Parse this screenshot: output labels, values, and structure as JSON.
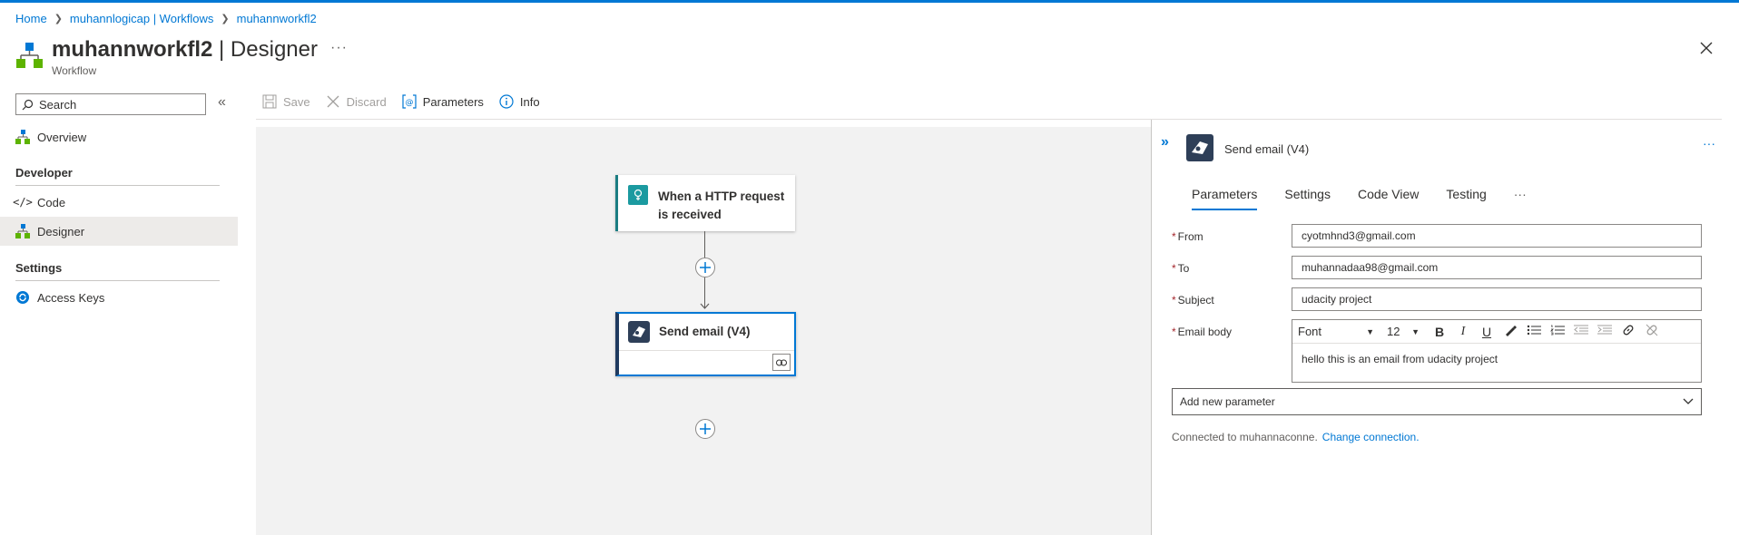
{
  "breadcrumb": {
    "home": "Home",
    "parent": "muhannlogicap | Workflows",
    "current": "muhannworkfl2"
  },
  "header": {
    "title_bold": "muhannworkfl2",
    "title_rest": " | Designer",
    "subtitle": "Workflow",
    "more": "···"
  },
  "sidebar": {
    "search_placeholder": "Search",
    "collapse": "«",
    "overview": "Overview",
    "developer_section": "Developer",
    "code": "Code",
    "designer": "Designer",
    "settings_section": "Settings",
    "access_keys": "Access Keys"
  },
  "toolbar": {
    "save": "Save",
    "discard": "Discard",
    "parameters": "Parameters",
    "info": "Info"
  },
  "canvas": {
    "trigger_title": "When a HTTP request is received",
    "action_title": "Send email (V4)"
  },
  "panel": {
    "expand": "»",
    "title": "Send email (V4)",
    "more": "···",
    "tabs": [
      "Parameters",
      "Settings",
      "Code View",
      "Testing"
    ],
    "tab_more": "···",
    "fields": {
      "from_label": "From",
      "from_value": "cyotmhnd3@gmail.com",
      "to_label": "To",
      "to_value": "muhannadaa98@gmail.com",
      "subject_label": "Subject",
      "subject_value": "udacity project",
      "body_label": "Email body",
      "body_value": "hello this is an email from udacity project"
    },
    "editor": {
      "font": "Font",
      "size": "12",
      "bold": "B",
      "italic": "I",
      "underline": "U"
    },
    "add_param": "Add new parameter",
    "connected_text": "Connected to muhannaconne.",
    "change_connection": "Change connection."
  },
  "colors": {
    "accent": "#0078d4",
    "trigger_teal": "#1b9aa0",
    "action_navy": "#2e3f58",
    "required": "#a4262c"
  }
}
